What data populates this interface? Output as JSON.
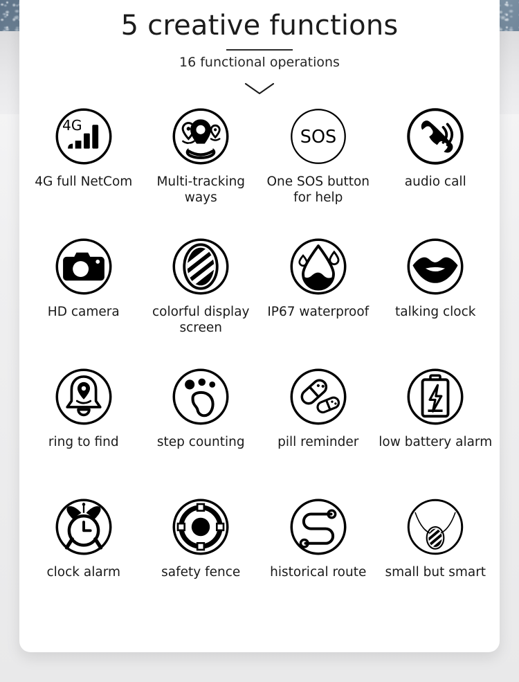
{
  "header": {
    "title": "5 creative functions",
    "subtitle": "16 functional operations",
    "chevron_icon": "chevron-down-icon"
  },
  "theme": {
    "card_background": "#ffffff",
    "page_background": "#eeeef0",
    "texture_color": "#7e8f9f",
    "text_color": "#191919",
    "icon_color": "#000000"
  },
  "features": [
    {
      "label": "4G full NetCom",
      "icon": "signal-4g-icon",
      "badge": "4G"
    },
    {
      "label": "Multi-tracking ways",
      "icon": "map-pins-icon"
    },
    {
      "label": "One SOS button for help",
      "icon": "sos-icon",
      "badge": "SOS"
    },
    {
      "label": "audio call",
      "icon": "phone-call-icon"
    },
    {
      "label": "HD camera",
      "icon": "camera-icon"
    },
    {
      "label": "colorful display screen",
      "icon": "display-screen-icon"
    },
    {
      "label": "IP67 waterproof",
      "icon": "water-drop-icon"
    },
    {
      "label": "talking clock",
      "icon": "lips-icon"
    },
    {
      "label": "ring to find",
      "icon": "bell-locator-icon"
    },
    {
      "label": "step counting",
      "icon": "footprint-icon"
    },
    {
      "label": "pill reminder",
      "icon": "pills-icon"
    },
    {
      "label": "low battery alarm",
      "icon": "battery-low-icon"
    },
    {
      "label": "clock alarm",
      "icon": "alarm-clock-icon"
    },
    {
      "label": "safety fence",
      "icon": "geofence-icon"
    },
    {
      "label": "historical route",
      "icon": "route-path-icon"
    },
    {
      "label": "small but smart",
      "icon": "necklace-pendant-icon"
    }
  ]
}
